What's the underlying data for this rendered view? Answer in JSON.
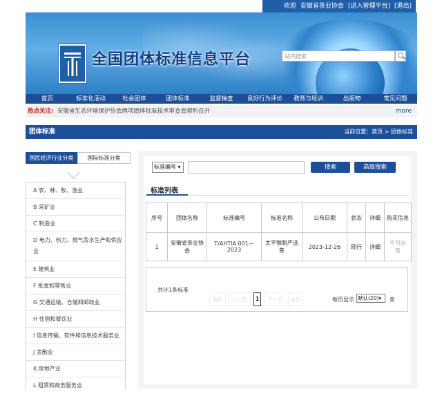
{
  "topbar": {
    "welcome": "欢迎",
    "org": "安徽省茶业协会",
    "admin_link": "[进入管理平台]",
    "logout_link": "[退出]"
  },
  "header": {
    "site_title": "全国团体标准信息平台",
    "search_placeholder": "站内搜索"
  },
  "nav": {
    "items": [
      "首页",
      "标准化活动",
      "社会团体",
      "团体标准",
      "监督抽查",
      "良好行为评价",
      "教育与培训",
      "出版物",
      "常见问题"
    ]
  },
  "news": {
    "label": "热点关注:",
    "text": "安徽省生态环境保护协会两项团体标准技术审查会顺利召开",
    "more": "more"
  },
  "section": {
    "title": "团体标准",
    "breadcrumb": "当前位置：首页 > 团体标准"
  },
  "sidebar": {
    "tab_active": "国民经济行业分类",
    "tab_other": "国际标准分类",
    "categories": [
      "A 农、林、牧、渔业",
      "B 采矿业",
      "C 制造业",
      "D 电力、热力、燃气及水生产和供应业",
      "E 建筑业",
      "F 批发和零售业",
      "G 交通运输、仓储和邮政业",
      "H 住宿和餐饮业",
      "I 信息传输、软件和信息技术服务业",
      "J 金融业",
      "K 房地产业",
      "L 租赁和商务服务业"
    ]
  },
  "search": {
    "select_value": "标准编号",
    "search_button": "搜索",
    "advanced_button": "高级搜索"
  },
  "list": {
    "title": "标准列表",
    "headers": [
      "序号",
      "团体名称",
      "标准编号",
      "标准名称",
      "公布日期",
      "状态",
      "详细",
      "购买信息"
    ],
    "rows": [
      [
        "1",
        "安徽省茶业协会",
        "T/AHTIA 001—2023",
        "太平猴魁严选茶",
        "2023-12-26",
        "现行",
        "详细",
        "不可出售"
      ]
    ]
  },
  "pager": {
    "total": "共计1条标准",
    "first": "首页",
    "prev": "上一页",
    "current": "1",
    "next": "下一页",
    "last": "末页",
    "per_page_label": "每页显示",
    "per_page_value": "默认(20)",
    "unit": "条"
  },
  "colors": {
    "primary": "#1d4f99",
    "hot": "#c0191b"
  }
}
